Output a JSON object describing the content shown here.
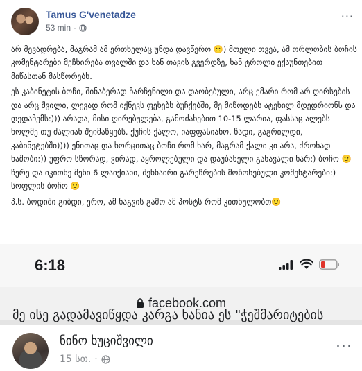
{
  "post": {
    "author": "Tamus G'venetadze",
    "time": "53 min",
    "separator": "·",
    "more": "···",
    "paragraphs": [
      "არ მევადრება, მაგრამ ამ ერთხელაც უნდა დავწერო 🙂) მთელი თვეა, ამ ორლობის ბოჩის კომენტარები მეჩხირება თვალში და ხან თავის გვერდზე, ხან ტროლი ექაუნთებით მიწასთან მასწორებს.",
      "ეს კაბინეტის ბოჩი, შინაბერად ჩარჩენილი და დაობებული, არც ქმარი რომ არ ღირსების და არც შვილი, ლევად რომ იქნევს ფეხებს ბუჩქებში, მე მიწოდებს ატეხილ მდედრიონს და დედაჩემს:))) არადა, მისი ღირებულება, გამოძახებით 10-15 ლარია, ფასსაც ალებს ხოლმე თუ ძალიან შეიმაწყებს. ქუჩის ქალო, იაფფასიანო, წადი, გაგრილდი, კაბინეტებში)))) ენითაც და ხორცითაც ბოჩი რომ ხარ, მაგრამ ქალი კი არა, ძროხად ნაშობი:)) უფრო სწორად, ვირად, აყროლებული და დაუბანელი განავალი ხარ:) ბოჩო 🙂 წერე და იკითხე შენი 6 ლაიქიანი, შენნაირი გარეწრების მოწონებული კომენტარები:) სოფლის ბოჩო 🙂"
    ],
    "ps": "პ.ს. ბოდიში გიბდი, ერო, ამ ნაგვის გამო ამ პოსტს რომ კითხულობთ🙂"
  },
  "screenshot": {
    "time": "6:18",
    "url": "facebook.com",
    "post": {
      "author": "ნინო ხუციშვილი",
      "time": "15 სთ.",
      "separator": "·",
      "more": "···",
      "snippet": "მე ისე გადამავიწყდა კარგა ხანია ეს \"ჭეშმარიტების"
    }
  },
  "colors": {
    "author_link": "#385898",
    "meta_text": "#616770",
    "body_text": "#1c1e21"
  }
}
